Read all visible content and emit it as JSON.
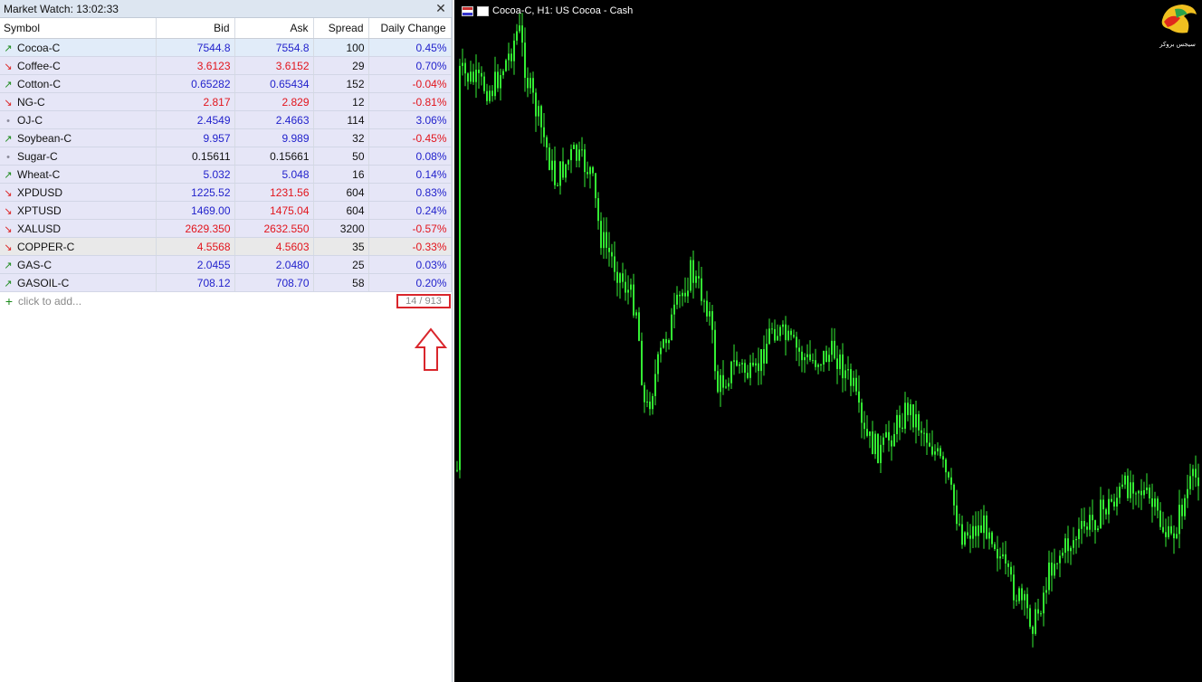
{
  "market_watch": {
    "title": "Market Watch: 13:02:33",
    "close_icon": "close-icon",
    "columns": [
      "Symbol",
      "Bid",
      "Ask",
      "Spread",
      "Daily Change"
    ],
    "rows": [
      {
        "symbol": "Cocoa-C",
        "trend": "up",
        "bid": "7544.8",
        "bid_color": "blue",
        "ask": "7554.8",
        "ask_color": "blue",
        "spread": "100",
        "change": "0.45%",
        "change_color": "blue"
      },
      {
        "symbol": "Coffee-C",
        "trend": "down",
        "bid": "3.6123",
        "bid_color": "red",
        "ask": "3.6152",
        "ask_color": "red",
        "spread": "29",
        "change": "0.70%",
        "change_color": "blue"
      },
      {
        "symbol": "Cotton-C",
        "trend": "up",
        "bid": "0.65282",
        "bid_color": "blue",
        "ask": "0.65434",
        "ask_color": "blue",
        "spread": "152",
        "change": "-0.04%",
        "change_color": "red"
      },
      {
        "symbol": "NG-C",
        "trend": "down",
        "bid": "2.817",
        "bid_color": "red",
        "ask": "2.829",
        "ask_color": "red",
        "spread": "12",
        "change": "-0.81%",
        "change_color": "red"
      },
      {
        "symbol": "OJ-C",
        "trend": "neutral",
        "bid": "2.4549",
        "bid_color": "blue",
        "ask": "2.4663",
        "ask_color": "blue",
        "spread": "114",
        "change": "3.06%",
        "change_color": "blue"
      },
      {
        "symbol": "Soybean-C",
        "trend": "up",
        "bid": "9.957",
        "bid_color": "blue",
        "ask": "9.989",
        "ask_color": "blue",
        "spread": "32",
        "change": "-0.45%",
        "change_color": "red"
      },
      {
        "symbol": "Sugar-C",
        "trend": "neutral",
        "bid": "0.15611",
        "bid_color": "black",
        "ask": "0.15661",
        "ask_color": "black",
        "spread": "50",
        "change": "0.08%",
        "change_color": "blue"
      },
      {
        "symbol": "Wheat-C",
        "trend": "up",
        "bid": "5.032",
        "bid_color": "blue",
        "ask": "5.048",
        "ask_color": "blue",
        "spread": "16",
        "change": "0.14%",
        "change_color": "blue"
      },
      {
        "symbol": "XPDUSD",
        "trend": "down",
        "bid": "1225.52",
        "bid_color": "blue",
        "ask": "1231.56",
        "ask_color": "red",
        "spread": "604",
        "change": "0.83%",
        "change_color": "blue"
      },
      {
        "symbol": "XPTUSD",
        "trend": "down",
        "bid": "1469.00",
        "bid_color": "blue",
        "ask": "1475.04",
        "ask_color": "red",
        "spread": "604",
        "change": "0.24%",
        "change_color": "blue"
      },
      {
        "symbol": "XALUSD",
        "trend": "down",
        "bid": "2629.350",
        "bid_color": "red",
        "ask": "2632.550",
        "ask_color": "red",
        "spread": "3200",
        "change": "-0.57%",
        "change_color": "red"
      },
      {
        "symbol": "COPPER-C",
        "trend": "down",
        "bid": "4.5568",
        "bid_color": "red",
        "ask": "4.5603",
        "ask_color": "red",
        "spread": "35",
        "change": "-0.33%",
        "change_color": "red"
      },
      {
        "symbol": "GAS-C",
        "trend": "up",
        "bid": "2.0455",
        "bid_color": "blue",
        "ask": "2.0480",
        "ask_color": "blue",
        "spread": "25",
        "change": "0.03%",
        "change_color": "blue"
      },
      {
        "symbol": "GASOIL-C",
        "trend": "up",
        "bid": "708.12",
        "bid_color": "blue",
        "ask": "708.70",
        "ask_color": "blue",
        "spread": "58",
        "change": "0.20%",
        "change_color": "blue"
      }
    ],
    "add_label": "click to add...",
    "count": "14 / 913"
  },
  "chart": {
    "title": "Cocoa-C, H1:  US Cocoa - Cash",
    "logo_text": "سیجس بروکر",
    "candle_color": "#33ee33",
    "background": "#000000"
  },
  "colors": {
    "blue": "#2222cc",
    "red": "#e2141c",
    "up_arrow": "#1a8a1a",
    "annotation_red": "#d9262c"
  }
}
